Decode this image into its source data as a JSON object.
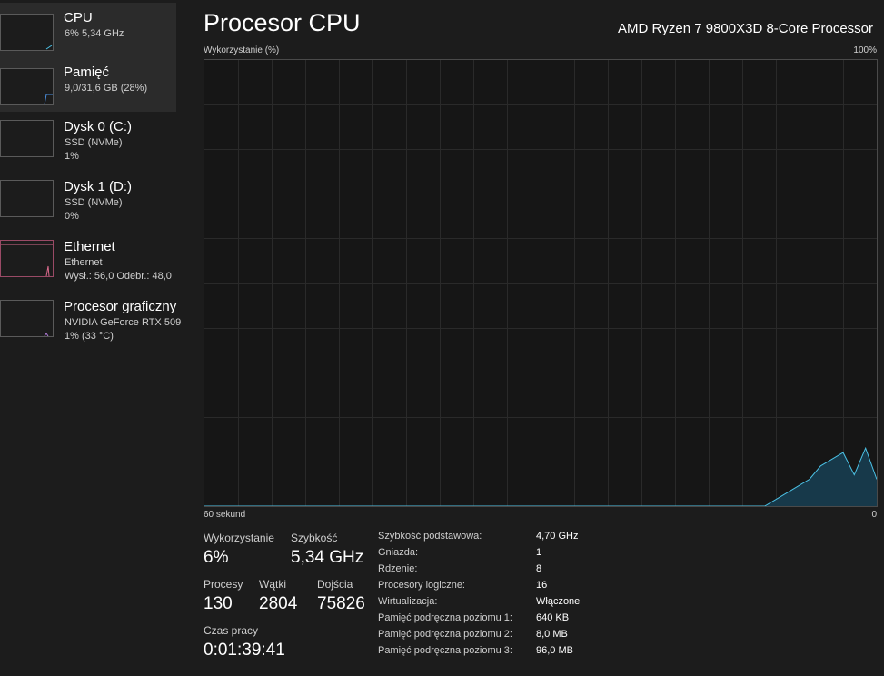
{
  "sidebar": {
    "items": [
      {
        "title": "CPU",
        "line1": "6% 5,34 GHz",
        "line2": "",
        "graph_color": "#4cc2e6",
        "active": true
      },
      {
        "title": "Pamięć",
        "line1": "9,0/31,6 GB (28%)",
        "line2": "",
        "graph_color": "#4a8fe0",
        "active": true
      },
      {
        "title": "Dysk 0 (C:)",
        "line1": "SSD (NVMe)",
        "line2": "1%",
        "graph_color": "#6cc04a",
        "active": false
      },
      {
        "title": "Dysk 1 (D:)",
        "line1": "SSD (NVMe)",
        "line2": "0%",
        "graph_color": "#6cc04a",
        "active": false
      },
      {
        "title": "Ethernet",
        "line1": "Ethernet",
        "line2": "Wysł.: 56,0  Odebr.: 48,0",
        "graph_color": "#d96a8c",
        "active": false
      },
      {
        "title": "Procesor graficzny",
        "line1": "NVIDIA GeForce RTX 509",
        "line2": "1%  (33 °C)",
        "graph_color": "#b07ad8",
        "active": false
      }
    ]
  },
  "header": {
    "title": "Procesor CPU",
    "processor": "AMD Ryzen 7 9800X3D 8-Core Processor"
  },
  "graph": {
    "y_label": "Wykorzystanie (%)",
    "y_max_label": "100%",
    "x_left_label": "60 sekund",
    "x_right_label": "0",
    "line_color": "#4cc2e6",
    "fill_color": "#17394a"
  },
  "chart_data": {
    "type": "area",
    "ylim": [
      0,
      100
    ],
    "xlim": [
      60,
      0
    ],
    "x": [
      60,
      10,
      8,
      6,
      5,
      3,
      2,
      1,
      0
    ],
    "values": [
      0,
      0,
      3,
      6,
      9,
      12,
      7,
      13,
      6
    ]
  },
  "stats": {
    "utilization": {
      "label": "Wykorzystanie",
      "value": "6%"
    },
    "speed": {
      "label": "Szybkość",
      "value": "5,34 GHz"
    },
    "processes": {
      "label": "Procesy",
      "value": "130"
    },
    "threads": {
      "label": "Wątki",
      "value": "2804"
    },
    "handles": {
      "label": "Dojścia",
      "value": "75826"
    },
    "uptime": {
      "label": "Czas pracy",
      "value": "0:01:39:41"
    }
  },
  "info": [
    {
      "key": "Szybkość podstawowa:",
      "value": "4,70 GHz"
    },
    {
      "key": "Gniazda:",
      "value": "1"
    },
    {
      "key": "Rdzenie:",
      "value": "8"
    },
    {
      "key": "Procesory logiczne:",
      "value": "16"
    },
    {
      "key": "Wirtualizacja:",
      "value": "Włączone"
    },
    {
      "key": "Pamięć podręczna poziomu 1:",
      "value": "640 KB"
    },
    {
      "key": "Pamięć podręczna poziomu 2:",
      "value": "8,0 MB"
    },
    {
      "key": "Pamięć podręczna poziomu 3:",
      "value": "96,0 MB"
    }
  ]
}
